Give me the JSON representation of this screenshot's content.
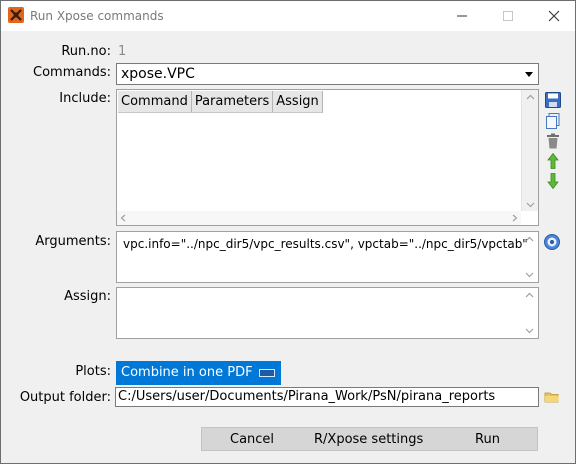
{
  "window": {
    "title": "Run Xpose commands",
    "icon": "pirana-app-icon"
  },
  "labels": {
    "run_no": "Run.no:",
    "commands": "Commands:",
    "include": "Include:",
    "arguments": "Arguments:",
    "assign": "Assign:",
    "plots": "Plots:",
    "output_folder": "Output folder:"
  },
  "run_no_value": "1",
  "commands_value": "xpose.VPC",
  "include_table": {
    "columns": [
      "Command",
      "Parameters",
      "Assign"
    ],
    "rows": []
  },
  "arguments_value": "vpc.info=\"../npc_dir5/vpc_results.csv\", vpctab=\"../npc_dir5/vpctab\"",
  "assign_value": "",
  "plots_value": "Combine in one PDF",
  "output_folder_value": "C:/Users/user/Documents/Pirana_Work/PsN/pirana_reports",
  "buttons": {
    "cancel": "Cancel",
    "settings": "R/Xpose settings",
    "run": "Run"
  },
  "side_icons": [
    "save-icon",
    "copy-icon",
    "trash-icon",
    "move-up-icon",
    "move-down-icon"
  ],
  "colors": {
    "accent": "#0078d7",
    "app_icon": "#e0661e"
  }
}
